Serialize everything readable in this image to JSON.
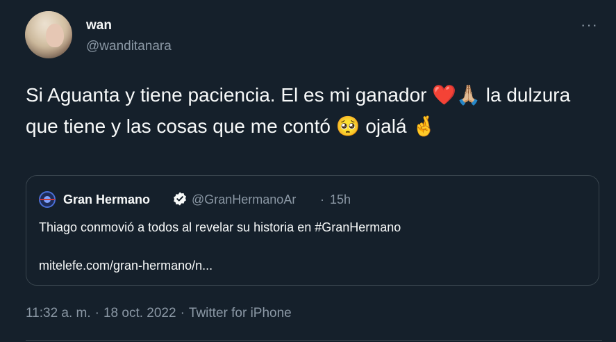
{
  "author": {
    "display_name": "wan",
    "handle": "@wanditanara"
  },
  "more_label": "···",
  "tweet_text": "Si Aguanta y tiene paciencia. El es mi ganador ❤️🙏🏼 la dulzura que tiene y las cosas que me contó 🥺 ojalá 🤞",
  "quoted": {
    "display_name": "Gran Hermano",
    "handle": "@GranHermanoAr",
    "dot": "·",
    "time": "15h",
    "text": "Thiago conmovió a todos al revelar su historia en #GranHermano",
    "link": "mitelefe.com/gran-hermano/n..."
  },
  "meta": {
    "time": "11:32 a. m.",
    "date": "18 oct. 2022",
    "source": "Twitter for iPhone",
    "sep": "·"
  },
  "colors": {
    "background": "#15202b",
    "border": "#38444d",
    "secondary_text": "#8b98a5",
    "primary_text": "#f7f9f9"
  }
}
